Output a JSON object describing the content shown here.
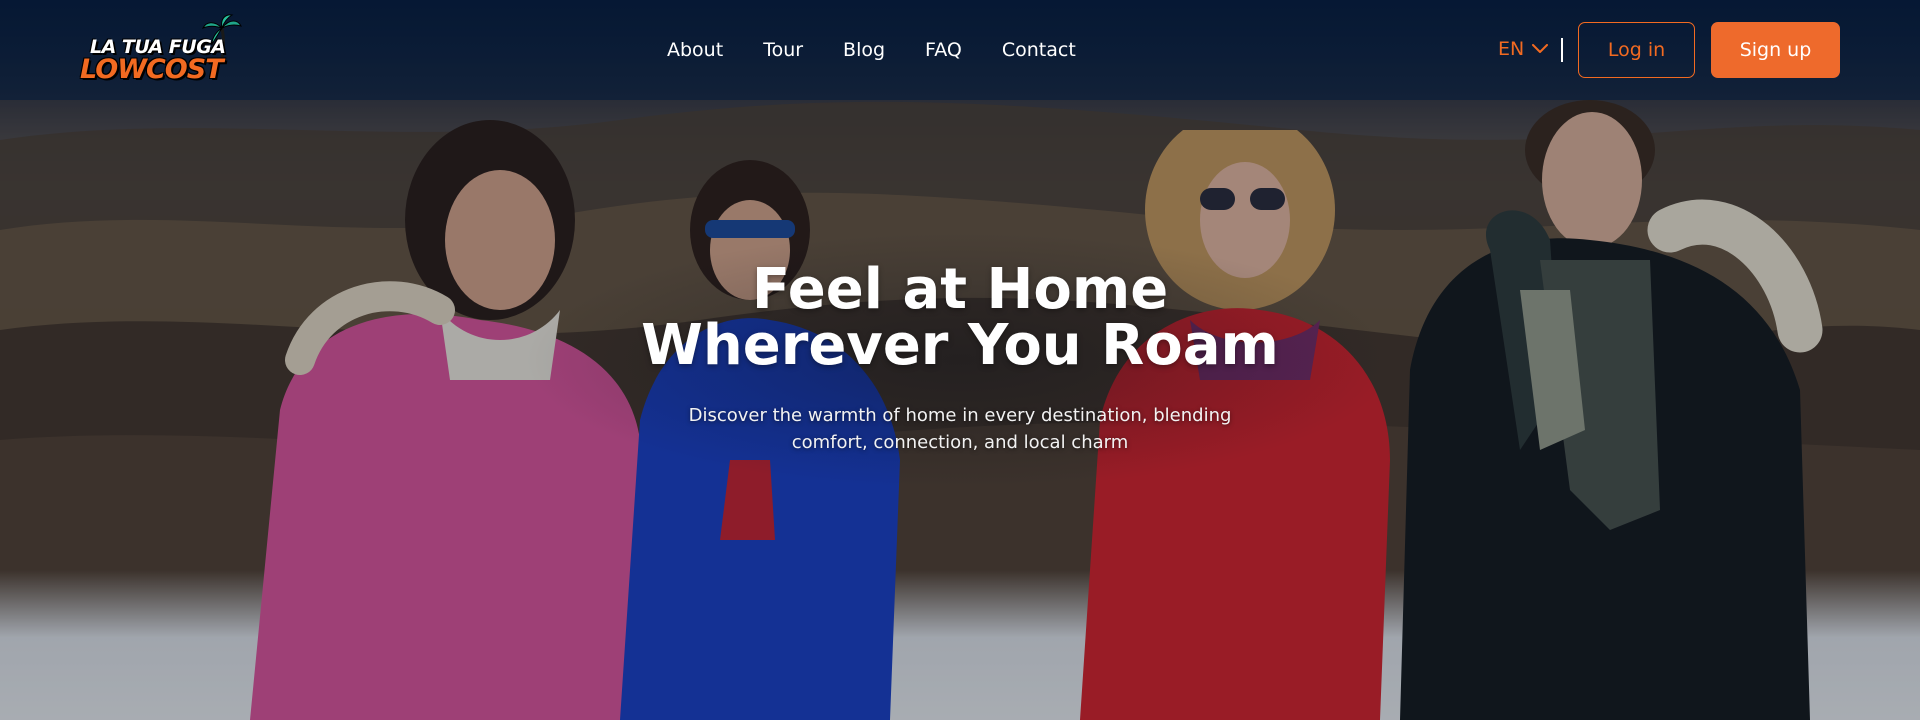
{
  "brand": {
    "logo_line1": "LA TUA FUGA",
    "logo_line2": "LOWCOST",
    "accent_color": "#f26a21"
  },
  "nav": {
    "items": [
      {
        "label": "About"
      },
      {
        "label": "Tour"
      },
      {
        "label": "Blog"
      },
      {
        "label": "FAQ"
      },
      {
        "label": "Contact"
      }
    ]
  },
  "header_actions": {
    "language": "EN",
    "language_icon": "chevron-down-icon",
    "login_label": "Log in",
    "signup_label": "Sign up"
  },
  "hero": {
    "title_line1": "Feel at Home",
    "title_line2": "Wherever You Roam",
    "subtitle": "Discover the warmth of home in every destination, blending comfort, connection, and local charm"
  }
}
